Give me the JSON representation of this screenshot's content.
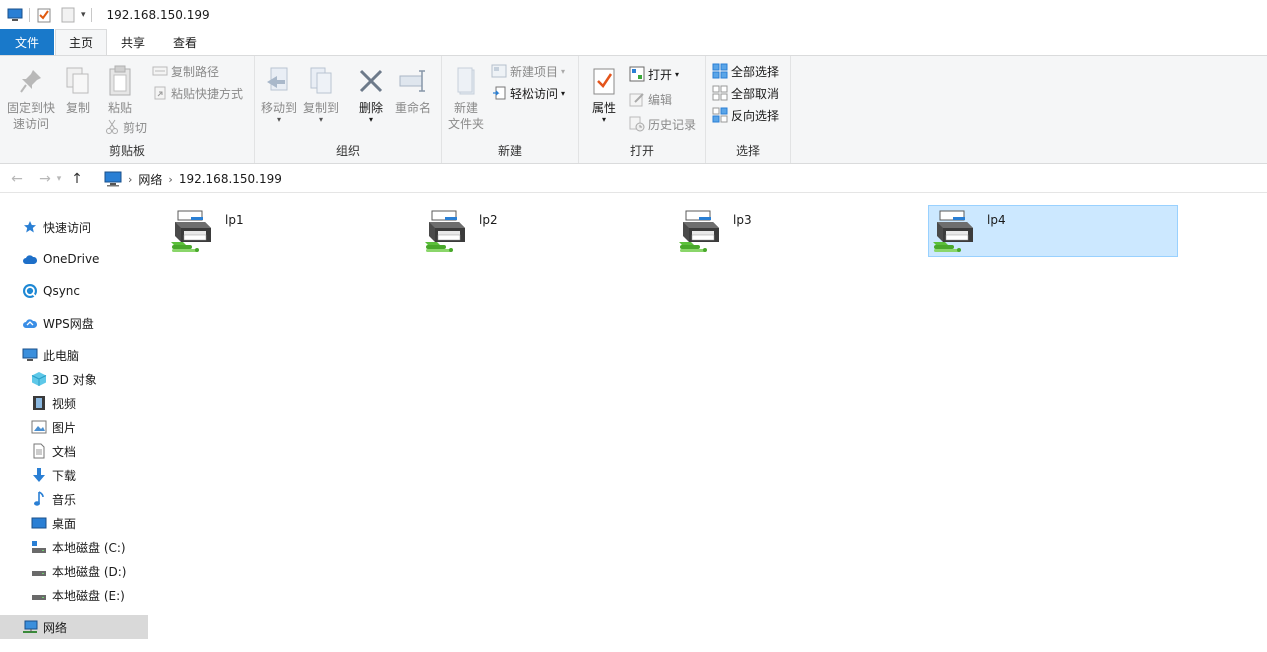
{
  "window": {
    "title": "192.168.150.199"
  },
  "tabs": [
    {
      "label": "文件"
    },
    {
      "label": "主页"
    },
    {
      "label": "共享"
    },
    {
      "label": "查看"
    }
  ],
  "ribbon": {
    "clipboard": {
      "label": "剪贴板",
      "pin": "固定到快\n速访问",
      "copy": "复制",
      "paste": "粘贴",
      "copy_path": "复制路径",
      "paste_shortcut": "粘贴快捷方式",
      "cut": "剪切"
    },
    "organize": {
      "label": "组织",
      "move_to": "移动到",
      "copy_to": "复制到",
      "delete": "删除",
      "rename": "重命名"
    },
    "new": {
      "label": "新建",
      "new_folder": "新建\n文件夹",
      "new_item": "新建项目",
      "easy_access": "轻松访问"
    },
    "open": {
      "label": "打开",
      "properties": "属性",
      "open": "打开",
      "edit": "编辑",
      "history": "历史记录"
    },
    "select": {
      "label": "选择",
      "select_all": "全部选择",
      "select_none": "全部取消",
      "invert": "反向选择"
    }
  },
  "address": {
    "crumbs": [
      "网络",
      "192.168.150.199"
    ]
  },
  "sidebar": {
    "items": [
      {
        "label": "快速访问"
      },
      {
        "label": "OneDrive"
      },
      {
        "label": "Qsync"
      },
      {
        "label": "WPS网盘"
      },
      {
        "label": "此电脑"
      },
      {
        "label": "3D 对象"
      },
      {
        "label": "视频"
      },
      {
        "label": "图片"
      },
      {
        "label": "文档"
      },
      {
        "label": "下载"
      },
      {
        "label": "音乐"
      },
      {
        "label": "桌面"
      },
      {
        "label": "本地磁盘 (C:)"
      },
      {
        "label": "本地磁盘 (D:)"
      },
      {
        "label": "本地磁盘 (E:)"
      },
      {
        "label": "网络"
      }
    ]
  },
  "content": {
    "items": [
      {
        "label": "lp1",
        "icon": "network-printer-icon"
      },
      {
        "label": "lp2",
        "icon": "network-printer-icon"
      },
      {
        "label": "lp3",
        "icon": "network-printer-icon"
      },
      {
        "label": "lp4",
        "icon": "network-printer-icon",
        "selected": true
      }
    ]
  },
  "colors": {
    "accent": "#1979ca",
    "selection": "#cce8ff",
    "selection_border": "#99d1ff"
  }
}
